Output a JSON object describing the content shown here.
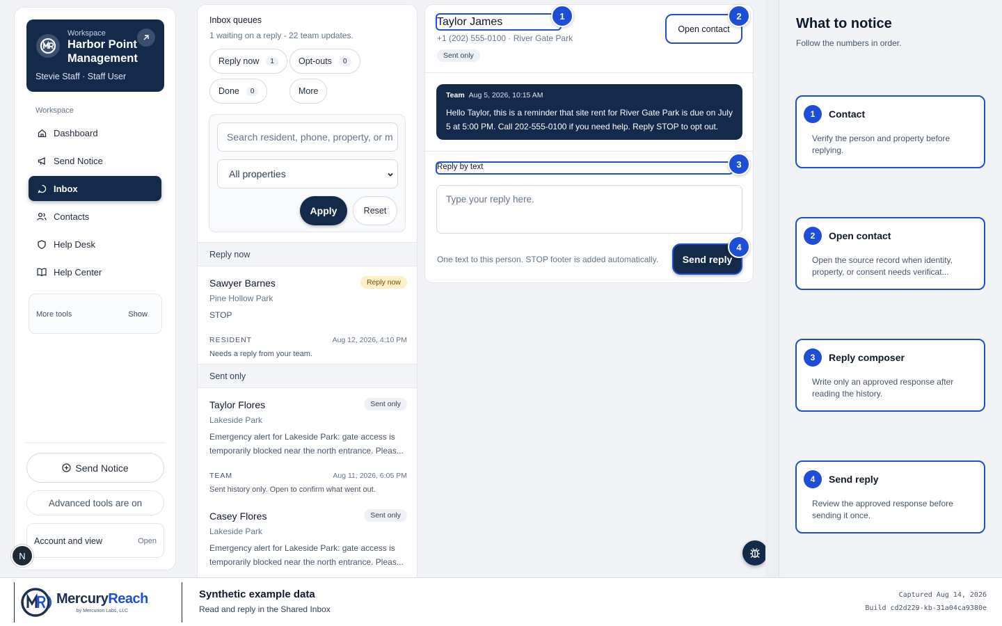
{
  "brand": {
    "workspace_label": "Workspace",
    "org_name": "Harbor Point Management",
    "user": "Stevie Staff · Staff User"
  },
  "sidebar": {
    "section_label": "Workspace",
    "items": [
      {
        "label": "Dashboard",
        "icon": "home-icon",
        "active": false
      },
      {
        "label": "Send Notice",
        "icon": "megaphone-icon",
        "active": false
      },
      {
        "label": "Inbox",
        "icon": "message-icon",
        "active": true
      },
      {
        "label": "Contacts",
        "icon": "users-icon",
        "active": false
      },
      {
        "label": "Help Desk",
        "icon": "shield-icon",
        "active": false
      },
      {
        "label": "Help Center",
        "icon": "book-icon",
        "active": false
      }
    ],
    "more_tools": {
      "label": "More tools",
      "toggle": "Show"
    },
    "send_notice_button": "Send Notice",
    "advanced_tools": "Advanced tools are on",
    "account": {
      "label": "Account and view",
      "action": "Open"
    },
    "dev_badge": "N"
  },
  "inbox": {
    "title": "Inbox queues",
    "subtitle": "1 waiting on a reply - 22 team updates.",
    "chips": [
      {
        "label": "Reply now",
        "count": "1"
      },
      {
        "label": "Opt-outs",
        "count": "0"
      },
      {
        "label": "Done",
        "count": "0"
      },
      {
        "label": "More",
        "count": ""
      }
    ],
    "search_placeholder": "Search resident, phone, property, or m",
    "property_filter": "All properties",
    "apply": "Apply",
    "reset": "Reset",
    "sections": [
      {
        "heading": "Reply now",
        "items": [
          {
            "name": "Sawyer Barnes",
            "badge": "Reply now",
            "property": "Pine Hollow Park",
            "message": "STOP",
            "role": "RESIDENT",
            "timestamp": "Aug 12, 2026, 4:10 PM",
            "note": "Needs a reply from your team."
          }
        ]
      },
      {
        "heading": "Sent only",
        "items": [
          {
            "name": "Taylor Flores",
            "badge": "Sent only",
            "property": "Lakeside Park",
            "message": "Emergency alert for Lakeside Park: gate access is temporarily blocked near the north entrance. Pleas...",
            "role": "TEAM",
            "timestamp": "Aug 11, 2026, 6:05 PM",
            "note": "Sent history only. Open to confirm what went out."
          },
          {
            "name": "Casey Flores",
            "badge": "Sent only",
            "property": "Lakeside Park",
            "message": "Emergency alert for Lakeside Park: gate access is temporarily blocked near the north entrance. Pleas...",
            "role": "",
            "timestamp": "",
            "note": ""
          }
        ]
      }
    ]
  },
  "conversation": {
    "name": "Taylor James",
    "phone_property": "+1 (202) 555-0100 · River Gate Park",
    "status": "Sent only",
    "open_contact": "Open contact",
    "message": {
      "sender": "Team",
      "timestamp": "Aug 5, 2026, 10:15 AM",
      "body": "Hello Taylor, this is a reminder that site rent for River Gate Park is due on July 5 at 5:00 PM. Call 202-555-0100 if you need help. Reply STOP to opt out."
    },
    "reply_label": "Reply by text",
    "reply_placeholder": "Type your reply here.",
    "hint": "One text to this person. STOP footer is added automatically.",
    "send": "Send reply"
  },
  "markers": [
    "1",
    "2",
    "3",
    "4"
  ],
  "notice": {
    "title": "What to notice",
    "subtitle": "Follow the numbers in order.",
    "cards": [
      {
        "num": "1",
        "title": "Contact",
        "body": "Verify the person and property before replying."
      },
      {
        "num": "2",
        "title": "Open contact",
        "body": "Open the source record when identity, property, or consent needs verificat..."
      },
      {
        "num": "3",
        "title": "Reply composer",
        "body": "Write only an approved response after reading the history."
      },
      {
        "num": "4",
        "title": "Send reply",
        "body": "Review the approved response before sending it once."
      }
    ]
  },
  "footer": {
    "logo_name_a": "Mercury",
    "logo_name_b": "Reach",
    "logo_by": "by Mercurion Labs, LLC",
    "title": "Synthetic example data",
    "subtitle": "Read and reply in the Shared Inbox",
    "captured": "Captured Aug 14, 2026",
    "build": "Build cd2d229-kb-31a04ca9380e"
  },
  "colors": {
    "navy": "#142a4a",
    "accent": "#1d4ed8",
    "reply_now_badge": "#fdf0c8"
  }
}
